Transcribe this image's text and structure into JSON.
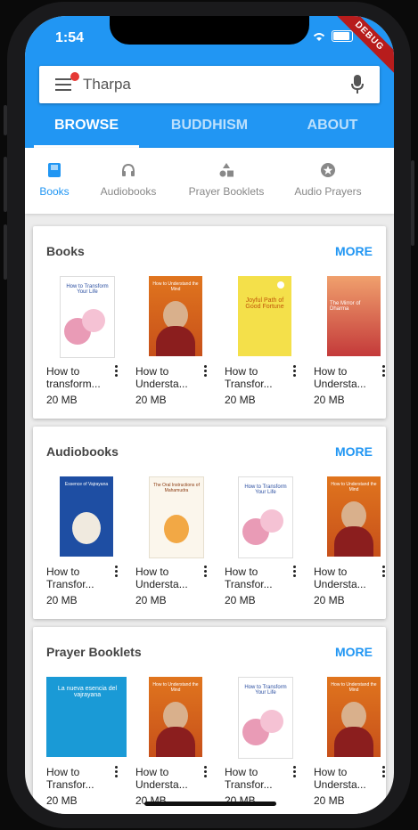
{
  "status": {
    "time": "1:54",
    "debug_banner": "DEBUG"
  },
  "search": {
    "value": "Tharpa"
  },
  "tabs": [
    {
      "label": "BROWSE",
      "active": true
    },
    {
      "label": "BUDDHISM",
      "active": false
    },
    {
      "label": "ABOUT",
      "active": false
    }
  ],
  "categories": [
    {
      "label": "Books",
      "icon": "book-icon",
      "active": true
    },
    {
      "label": "Audiobooks",
      "icon": "headphones-icon",
      "active": false
    },
    {
      "label": "Prayer Booklets",
      "icon": "shapes-icon",
      "active": false
    },
    {
      "label": "Audio Prayers",
      "icon": "star-circle-icon",
      "active": false
    }
  ],
  "sections": [
    {
      "title": "Books",
      "more": "MORE",
      "items": [
        {
          "title": "How to transform...",
          "size": "20 MB",
          "cover": "transform-your-life"
        },
        {
          "title": "How to Understa...",
          "size": "20 MB",
          "cover": "understand-the-mind"
        },
        {
          "title": "How to Transfor...",
          "size": "20 MB",
          "cover": "joyful-path"
        },
        {
          "title": "How to Understa...",
          "size": "20 MB",
          "cover": "mirror-of-dharma"
        }
      ]
    },
    {
      "title": "Audiobooks",
      "more": "MORE",
      "items": [
        {
          "title": "How to Transfor...",
          "size": "20 MB",
          "cover": "essence-of-vajrayana"
        },
        {
          "title": "How to Understa...",
          "size": "20 MB",
          "cover": "oral-instructions"
        },
        {
          "title": "How to Transfor...",
          "size": "20 MB",
          "cover": "transform-your-life"
        },
        {
          "title": "How to Understa...",
          "size": "20 MB",
          "cover": "understand-the-mind"
        }
      ]
    },
    {
      "title": "Prayer Booklets",
      "more": "MORE",
      "items": [
        {
          "title": "How to Transfor...",
          "size": "20 MB",
          "cover": "nueva-esencia"
        },
        {
          "title": "How to Understa...",
          "size": "20 MB",
          "cover": "understand-the-mind"
        },
        {
          "title": "How to Transfor...",
          "size": "20 MB",
          "cover": "transform-your-life"
        },
        {
          "title": "How to Understa...",
          "size": "20 MB",
          "cover": "understand-the-mind"
        }
      ]
    }
  ],
  "covers": {
    "transform-your-life": {
      "title": "How to Transform Your Life"
    },
    "understand-the-mind": {
      "title": "How to Understand the Mind"
    },
    "joyful-path": {
      "title": "Joyful Path of Good Fortune"
    },
    "mirror-of-dharma": {
      "title": "The Mirror of Dharma"
    },
    "essence-of-vajrayana": {
      "title": "Essence of Vajrayana"
    },
    "oral-instructions": {
      "title": "The Oral Instructions of Mahamudra"
    },
    "nueva-esencia": {
      "title": "La nueva esencia del vajrayana",
      "subtitle": ""
    }
  },
  "colors": {
    "primary": "#2196f3",
    "debug": "#b71c1c"
  }
}
